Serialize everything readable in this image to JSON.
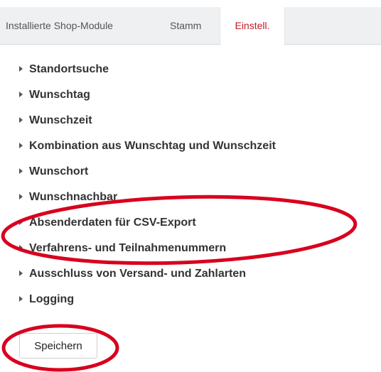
{
  "tabs": [
    {
      "label": "Installierte Shop-Module",
      "active": false
    },
    {
      "label": "Stamm",
      "active": false
    },
    {
      "label": "Einstell.",
      "active": true
    }
  ],
  "sections": [
    {
      "label": "Standortsuche"
    },
    {
      "label": "Wunschtag"
    },
    {
      "label": "Wunschzeit"
    },
    {
      "label": "Kombination aus Wunschtag und Wunschzeit"
    },
    {
      "label": "Wunschort"
    },
    {
      "label": "Wunschnachbar"
    },
    {
      "label": "Absenderdaten für CSV-Export"
    },
    {
      "label": "Verfahrens- und Teilnahmenummern"
    },
    {
      "label": "Ausschluss von Versand- und Zahlarten"
    },
    {
      "label": "Logging"
    }
  ],
  "save_button": {
    "label": "Speichern"
  },
  "colors": {
    "active_tab_text": "#c21b2a",
    "annotation_ellipse": "#d8001e",
    "tab_bar_background": "#eef0f2"
  },
  "icons": {
    "section_toggle": "caret-right-icon"
  }
}
